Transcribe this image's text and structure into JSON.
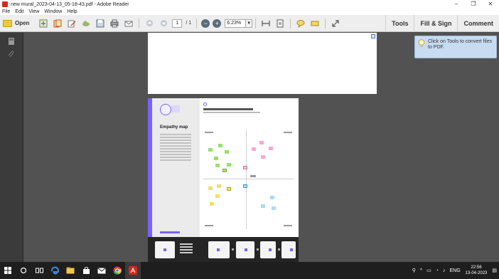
{
  "window": {
    "title": "new mural_2023-04-13_05-18-43.pdf - Adobe Reader",
    "controls": [
      "–",
      "❐",
      "✕"
    ]
  },
  "menu": [
    "File",
    "Edit",
    "View",
    "Window",
    "Help"
  ],
  "toolbar": {
    "open_label": "Open",
    "page_current": "1",
    "page_total": "/ 1",
    "zoom_value": "6.23%",
    "zoom_dropdown": "▼",
    "right_tabs": [
      "Tools",
      "Fill & Sign",
      "Comment"
    ]
  },
  "document": {
    "page2_title": "Empathy map"
  },
  "tooltip": {
    "message": "Click on Tools to convert files to PDF."
  },
  "taskbar": {
    "tray_lang": "ENG",
    "time": "22:56",
    "date": "13-04-2023"
  },
  "colors": {
    "accent": "#7b61ff",
    "adobe_red": "#d8271c",
    "tooltip_bg": "#c7dcf0",
    "doc_bg": "#525252"
  }
}
